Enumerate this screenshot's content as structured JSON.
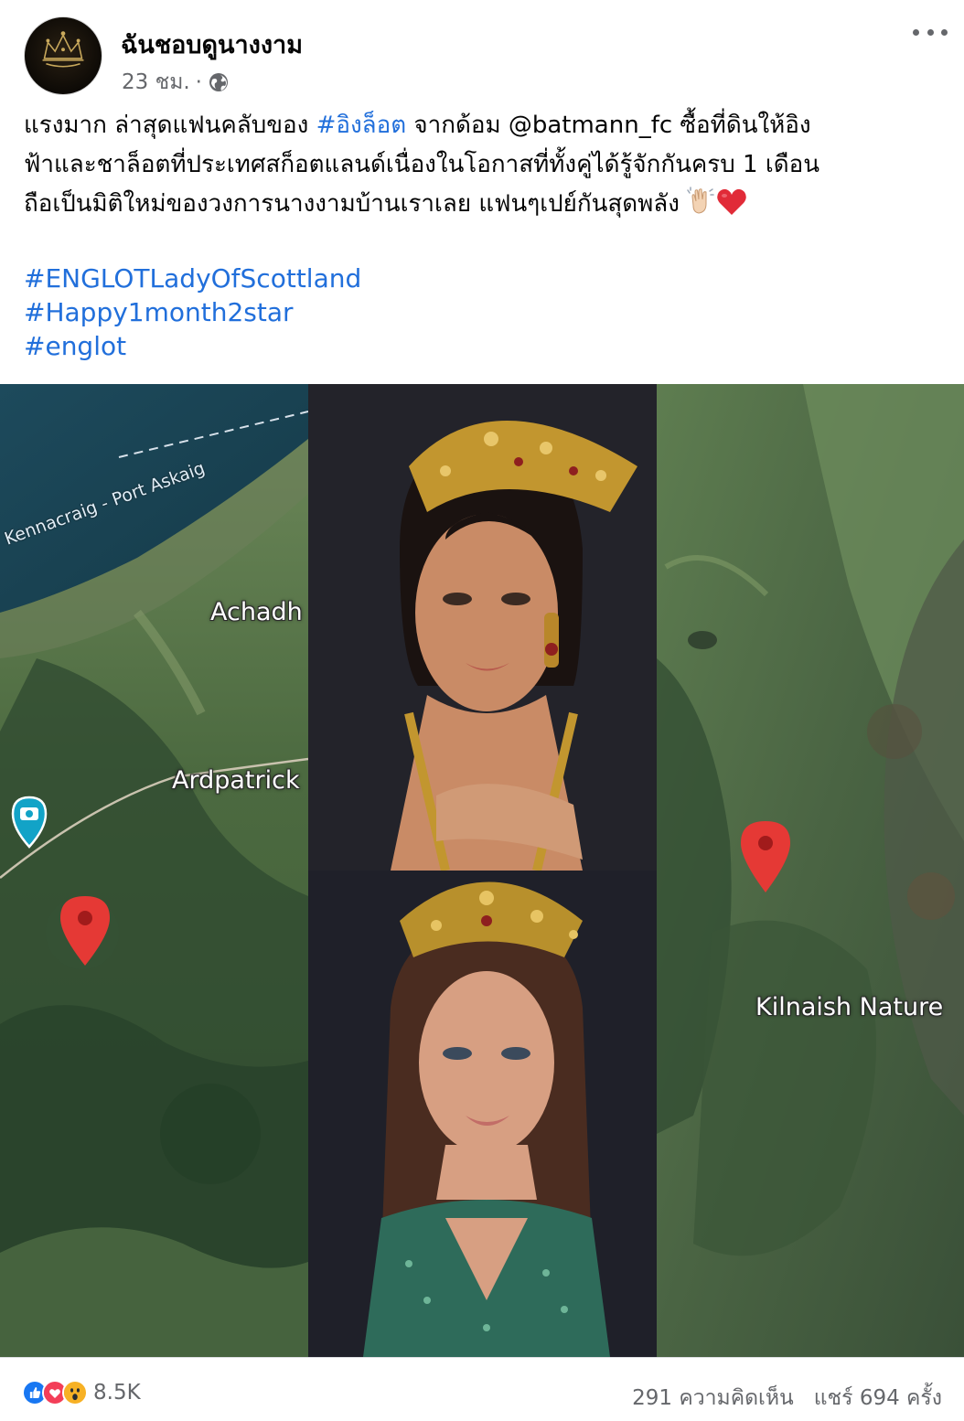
{
  "post": {
    "page_name": "ฉันชอบดูนางงาม",
    "time": "23 ชม.",
    "separator": "·",
    "avatar_logo_text": "ฉันชอบดูนางงาม",
    "text_line1_a": "แรงมาก ล่าสุดแฟนคลับของ ",
    "text_line1_tag": "#อิงล็อต",
    "text_line1_b": " จากด้อม @batmann_fc ซื้อที่ดินให้อิง",
    "text_line2": "ฟ้าและชาล็อตที่ประเทศสก็อตแลนด์เนื่องในโอกาสที่ทั้งคู่ได้รู้จักกันครบ 1 เดือน",
    "text_line3": "ถือเป็นมิติใหม่ของวงการนางงามบ้านเราเลย แฟนๆเปย์กันสุดพลัง",
    "hashtags": [
      "#ENGLOTLadyOfScottland",
      "#Happy1month2star",
      "#englot"
    ]
  },
  "media": {
    "map_labels": {
      "ferry": "Kennacraig - Port Askaig",
      "achadh": "Achadh",
      "ardpatrick": "Ardpatrick",
      "kilnaish": "Kilnaish Nature"
    }
  },
  "stats": {
    "reaction_count": "8.5K",
    "comments": "291 ความคิดเห็น",
    "shares": "แชร์ 694 ครั้ง"
  },
  "colors": {
    "link": "#216fdb",
    "secondary_text": "#65676b",
    "like_blue": "#1877f2",
    "love_red": "#f33e58",
    "wow_yellow": "#f7b125",
    "pin_red": "#e53935"
  }
}
